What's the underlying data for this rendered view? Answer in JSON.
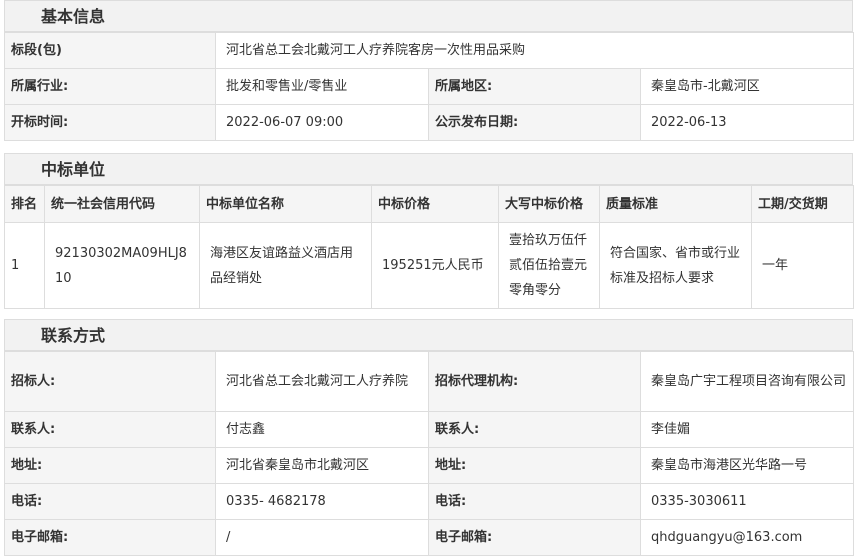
{
  "basic": {
    "title": "基本信息",
    "bid_label": "标段(包)",
    "bid_value": "河北省总工会北戴河工人疗养院客房一次性用品采购",
    "industry_label": "所属行业:",
    "industry_value": "批发和零售业/零售业",
    "region_label": "所属地区:",
    "region_value": "秦皇岛市-北戴河区",
    "open_time_label": "开标时间:",
    "open_time_value": "2022-06-07 09:00",
    "publish_date_label": "公示发布日期:",
    "publish_date_value": "2022-06-13"
  },
  "winner": {
    "title": "中标单位",
    "headers": [
      "排名",
      "统一社会信用代码",
      "中标单位名称",
      "中标价格",
      "大写中标价格",
      "质量标准",
      "工期/交货期"
    ],
    "row": {
      "rank": "1",
      "credit_code": "92130302MA09HLJ810",
      "name": "海港区友谊路益义酒店用品经销处",
      "price": "195251元人民币",
      "price_upper": "壹拾玖万伍仟贰佰伍拾壹元零角零分",
      "quality": "符合国家、省市或行业标准及招标人要求",
      "period": "一年"
    }
  },
  "contact": {
    "title": "联系方式",
    "tenderer_label": "招标人:",
    "tenderer_value": "河北省总工会北戴河工人疗养院",
    "agency_label": "招标代理机构:",
    "agency_value": "秦皇岛广宇工程项目咨询有限公司",
    "contact_label_1": "联系人:",
    "contact_value_1": "付志鑫",
    "contact_label_2": "联系人:",
    "contact_value_2": "李佳媚",
    "address_label_1": "地址:",
    "address_value_1": "河北省秦皇岛市北戴河区",
    "address_label_2": "地址:",
    "address_value_2": "秦皇岛市海港区光华路一号",
    "phone_label_1": "电话:",
    "phone_value_1": "0335- 4682178",
    "phone_label_2": "电话:",
    "phone_value_2": "0335-3030611",
    "email_label_1": "电子邮箱:",
    "email_value_1": "/",
    "email_label_2": "电子邮箱:",
    "email_value_2": "qhdguangyu@163.com"
  }
}
